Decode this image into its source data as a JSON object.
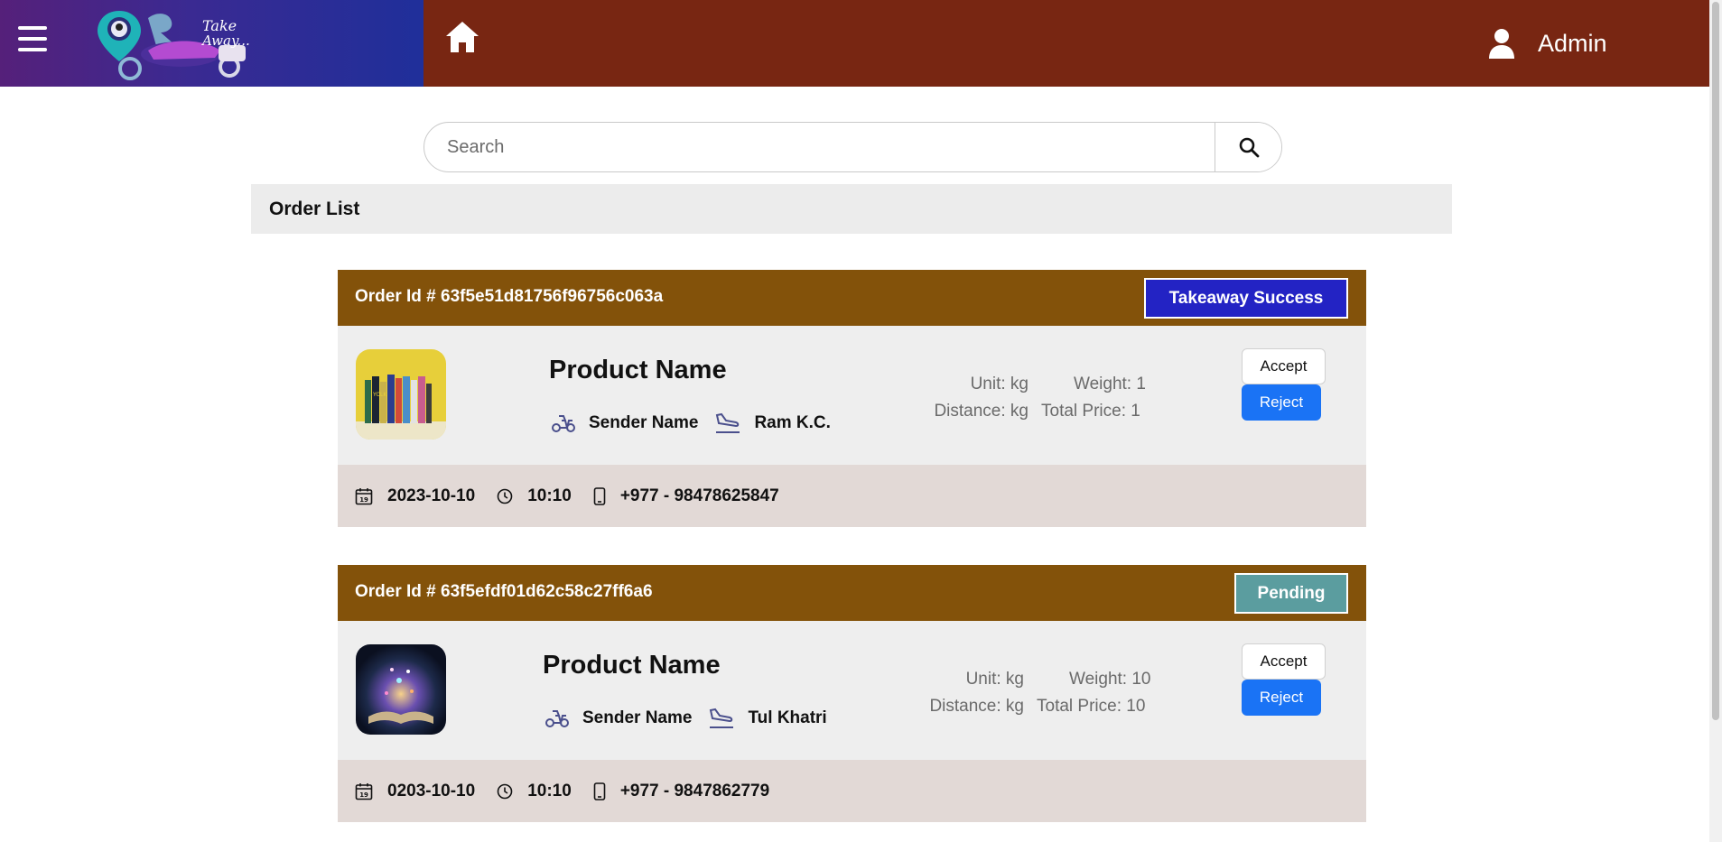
{
  "header": {
    "user_label": "Admin",
    "logo_text_line1": "Take",
    "logo_text_line2": "Away..."
  },
  "search": {
    "placeholder": "Search",
    "value": ""
  },
  "order_list": {
    "title": "Order List"
  },
  "orders": [
    {
      "order_id": "Order Id # 63f5e51d81756f96756c063a",
      "status": "Takeaway Success",
      "status_color": "#2323c4",
      "product_name": "Product Name",
      "sender": "Sender Name",
      "receiver": "Ram K.C.",
      "unit": "Unit: kg",
      "weight": "Weight: 1",
      "distance": "Distance: kg",
      "total_price": "Total Price: 1",
      "accept_label": "Accept",
      "reject_label": "Reject",
      "date": "2023-10-10",
      "time": "10:10",
      "phone": "+977 - 98478625847",
      "thumbnail": "books-on-yellow"
    },
    {
      "order_id": "Order Id # 63f5efdf01d62c58c27ff6a6",
      "status": "Pending",
      "status_color": "#5b9d9f",
      "product_name": "Product Name",
      "sender": "Sender Name",
      "receiver": "Tul Khatri",
      "unit": "Unit: kg",
      "weight": "Weight: 10",
      "distance": "Distance: kg",
      "total_price": "Total Price: 10",
      "accept_label": "Accept",
      "reject_label": "Reject",
      "date": "0203-10-10",
      "time": "10:10",
      "phone": "+977 - 9847862779",
      "thumbnail": "glowing-open-book"
    }
  ],
  "colors": {
    "header_bg": "#782612",
    "card_header_bg": "#83520a",
    "reject_bg": "#1a73f5"
  }
}
